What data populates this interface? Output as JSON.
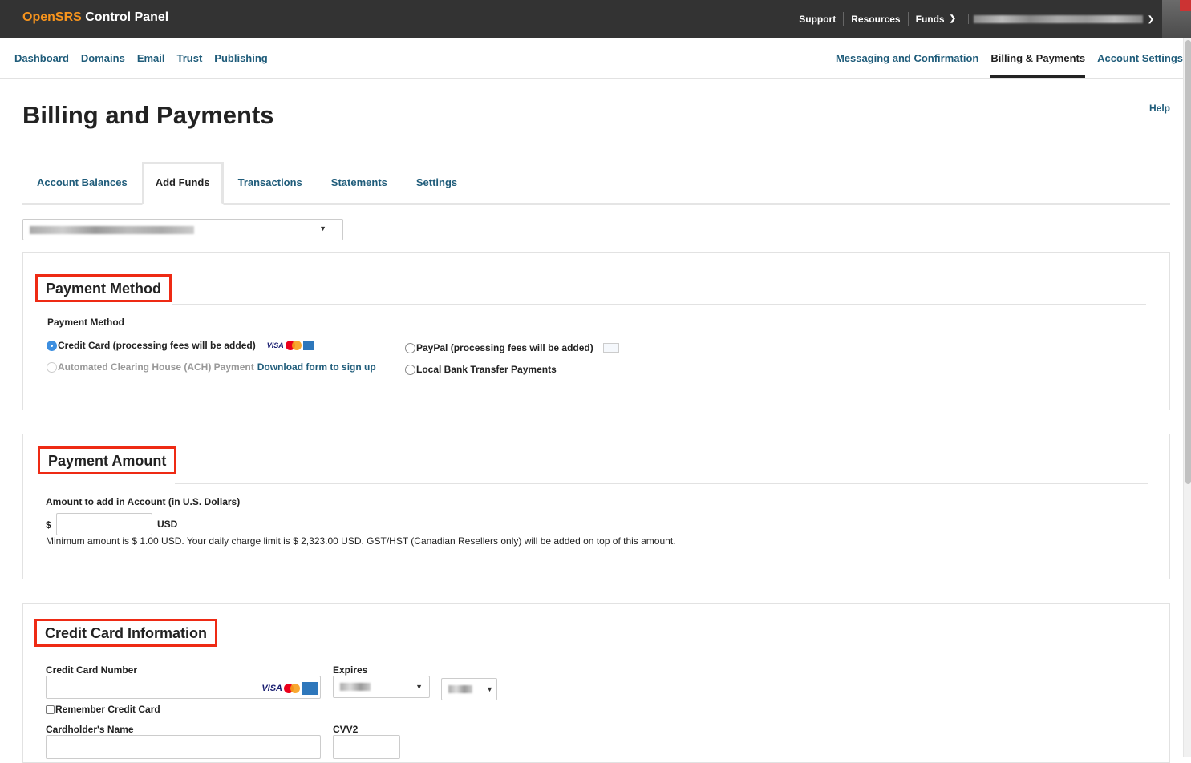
{
  "brand": {
    "part1": "OpenSRS",
    "part2": " Control Panel"
  },
  "topnav": {
    "support": "Support",
    "resources": "Resources",
    "funds": "Funds"
  },
  "mainnav": {
    "left": [
      "Dashboard",
      "Domains",
      "Email",
      "Trust",
      "Publishing"
    ],
    "right": [
      "Messaging and Confirmation",
      "Billing & Payments",
      "Account Settings"
    ],
    "active": "Billing & Payments"
  },
  "page": {
    "title": "Billing and Payments",
    "help": "Help"
  },
  "tabs": [
    "Account Balances",
    "Add Funds",
    "Transactions",
    "Statements",
    "Settings"
  ],
  "active_tab": "Add Funds",
  "payment_method": {
    "heading": "Payment Method",
    "label": "Payment Method",
    "options": {
      "credit_card": "Credit Card (processing fees will be added)",
      "ach": "Automated Clearing House (ACH) Payment",
      "ach_link": "Download form to sign up",
      "paypal": "PayPal (processing fees will be added)",
      "local_bank": "Local Bank Transfer Payments"
    },
    "selected": "credit_card"
  },
  "payment_amount": {
    "heading": "Payment Amount",
    "label": "Amount to add in Account (in U.S. Dollars)",
    "currency_symbol": "$",
    "currency_code": "USD",
    "value": "",
    "note": "Minimum amount is $ 1.00 USD. Your daily charge limit is $ 2,323.00 USD. GST/HST (Canadian Resellers only) will be added on top of this amount."
  },
  "credit_card": {
    "heading": "Credit Card Information",
    "number_label": "Credit Card Number",
    "expires_label": "Expires",
    "remember_label": "Remember Credit Card",
    "name_label": "Cardholder's Name",
    "cvv_label": "CVV2",
    "visa": "VISA"
  },
  "colors": {
    "topbar": "#333333",
    "brand_accent": "#f7941d",
    "link": "#1f5c7a",
    "highlight": "#ee2a14"
  }
}
